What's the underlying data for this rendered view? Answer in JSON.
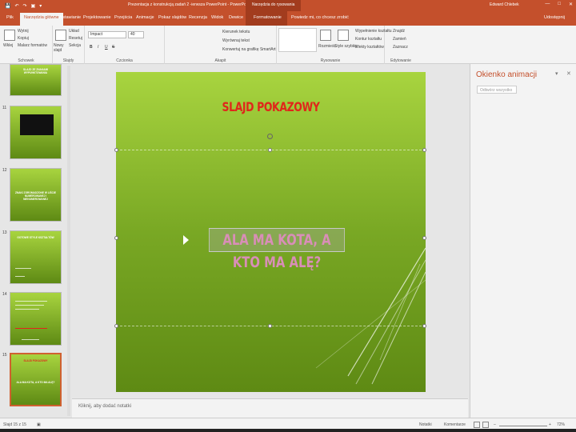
{
  "window": {
    "title": "Prezentacja z konstrukcją zadań 2 -ierwsza PowerPoint - PowerPoint",
    "context_group": "Narzędzia do rysowania",
    "user": "Edward Chlebek",
    "controls": [
      "—",
      "□",
      "✕"
    ]
  },
  "quick_access": [
    "💾",
    "↶",
    "↷",
    "▣",
    "▾"
  ],
  "tabs": [
    "Plik",
    "Narzędzia główne",
    "Wstawianie",
    "Projektowanie",
    "Przejścia",
    "Animacje",
    "Pokaz slajdów",
    "Recenzja",
    "Widok",
    "Dewice",
    "Formatowanie"
  ],
  "active_tab": "Narzędzia główne",
  "tell_me": "Powiedz mi, co chcesz zrobić",
  "share": "Udostępnij",
  "ribbon": {
    "clipboard": {
      "paste": "Wklej",
      "cut": "Wytnij",
      "copy": "Kopiuj",
      "format_painter": "Malarz formatów",
      "label": "Schowek"
    },
    "slides": {
      "new_slide": "Nowy slajd",
      "layout": "Układ",
      "reset": "Resetuj",
      "section": "Sekcja",
      "label": "Slajdy"
    },
    "font": {
      "font_name": "Impact",
      "font_size": "40",
      "bold": "B",
      "italic": "I",
      "underline": "U",
      "strike": "S",
      "label": "Czcionka"
    },
    "paragraph": {
      "text_direction": "Kierunek tekstu",
      "align_text": "Wyrównaj tekst",
      "smartart": "Konwertuj na grafikę SmartArt",
      "label": "Akapit"
    },
    "drawing": {
      "arrange": "Rozmieść",
      "quick_styles": "Style szybkie",
      "label": "Rysowanie",
      "fill": "Wypełnienie kształtu",
      "outline": "Kontur kształtu",
      "effects": "Efekty kształtów"
    },
    "editing": {
      "find": "Znajdź",
      "replace": "Zamień",
      "select": "Zaznacz",
      "label": "Edytowanie"
    }
  },
  "thumbnails": [
    {
      "number": "",
      "title": "SLAJD ZE ZNAKAMI WYPUNKTOWANIA"
    },
    {
      "number": "11",
      "title": ""
    },
    {
      "number": "12",
      "title": "ZNAKI ZGROMADZONE W LIŚCIE NUMEROWANEJ I NIENUMEROWANEJ"
    },
    {
      "number": "13",
      "title": "GOTOWE STYLE KSZTAŁTÓW"
    },
    {
      "number": "14",
      "title": ""
    },
    {
      "number": "15",
      "title": "SLAJD POKAZOWY"
    }
  ],
  "active_slide": 15,
  "slide": {
    "title": "SLAJD POKAZOWY",
    "body": "ALA MA KOTA, A KTO MA ALĘ?"
  },
  "thumbnail_15": {
    "title": "SLAJD POKAZOWY",
    "body": "ALA MA KOTA, A KTO MA ALĘ?"
  },
  "notes_placeholder": "Kliknij, aby dodać notatki",
  "animation_pane": {
    "title": "Okienko animacji",
    "play_button": "Odtwórz wszystko",
    "controls": [
      "▾",
      "✕"
    ]
  },
  "status": {
    "slide_counter": "Slajd 15 z 15",
    "language_icon": "▣",
    "notes": "Notatki",
    "comments": "Komentarze",
    "zoom_minus": "–",
    "zoom_plus": "+",
    "zoom": "72%"
  },
  "colors": {
    "accent": "#c4502c",
    "slide_top": "#a8d43f",
    "slide_bottom": "#5e8a14",
    "title_red": "#e0261b"
  }
}
